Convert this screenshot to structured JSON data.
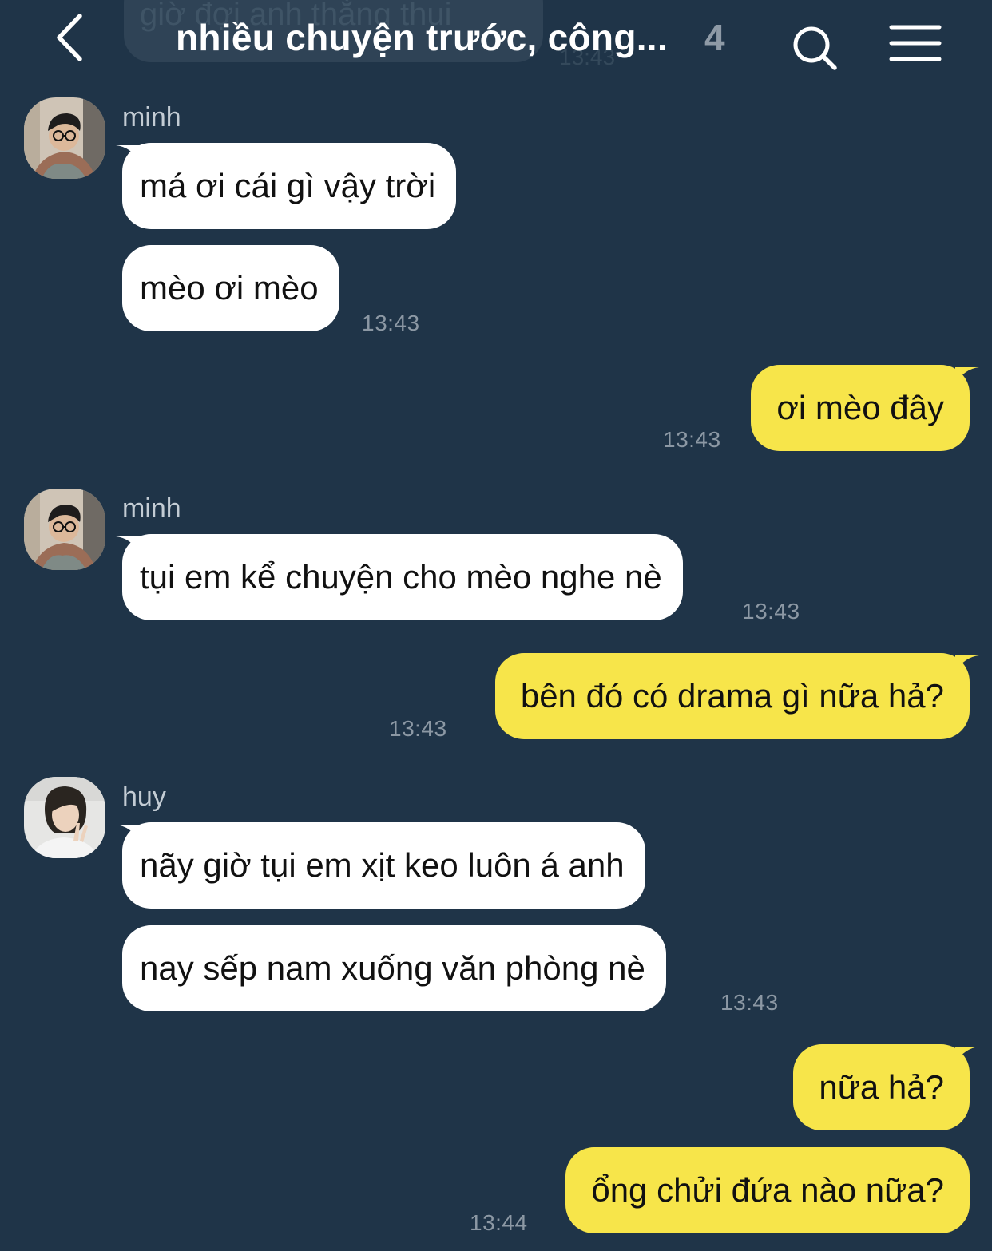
{
  "header": {
    "ghost_message": "giờ đợi anh thằng thui",
    "ghost_time": "13:43",
    "title": "nhiều chuyện trước, công...",
    "member_count": "4",
    "back_icon": "chevron-left-icon",
    "search_icon": "search-icon",
    "menu_icon": "menu-icon"
  },
  "colors": {
    "background": "#1f3448",
    "incoming_bubble": "#ffffff",
    "outgoing_bubble": "#f7e54a",
    "timestamp": "#8c98a4",
    "sender_name": "#c3ccd4"
  },
  "messages": [
    {
      "id": "g1",
      "type": "incoming",
      "sender": "minh",
      "bubbles": [
        "má ơi cái gì vậy trời",
        "mèo ơi mèo"
      ],
      "time": "13:43"
    },
    {
      "id": "m3",
      "type": "outgoing",
      "text": "ơi mèo đây",
      "time": "13:43"
    },
    {
      "id": "g2",
      "type": "incoming",
      "sender": "minh",
      "bubbles": [
        "tụi em kể chuyện cho mèo nghe nè"
      ],
      "time": "13:43"
    },
    {
      "id": "m5",
      "type": "outgoing",
      "text": "bên đó có drama gì nữa hả?",
      "time": "13:43"
    },
    {
      "id": "g3",
      "type": "incoming",
      "sender": "huy",
      "bubbles": [
        "nãy giờ tụi em xịt keo luôn á anh",
        "nay sếp nam xuống văn phòng nè"
      ],
      "time": "13:43"
    },
    {
      "id": "m8",
      "type": "outgoing",
      "text": "nữa hả?"
    },
    {
      "id": "m9",
      "type": "outgoing",
      "text": "ổng chửi đứa nào nữa?",
      "time": "13:44"
    }
  ]
}
